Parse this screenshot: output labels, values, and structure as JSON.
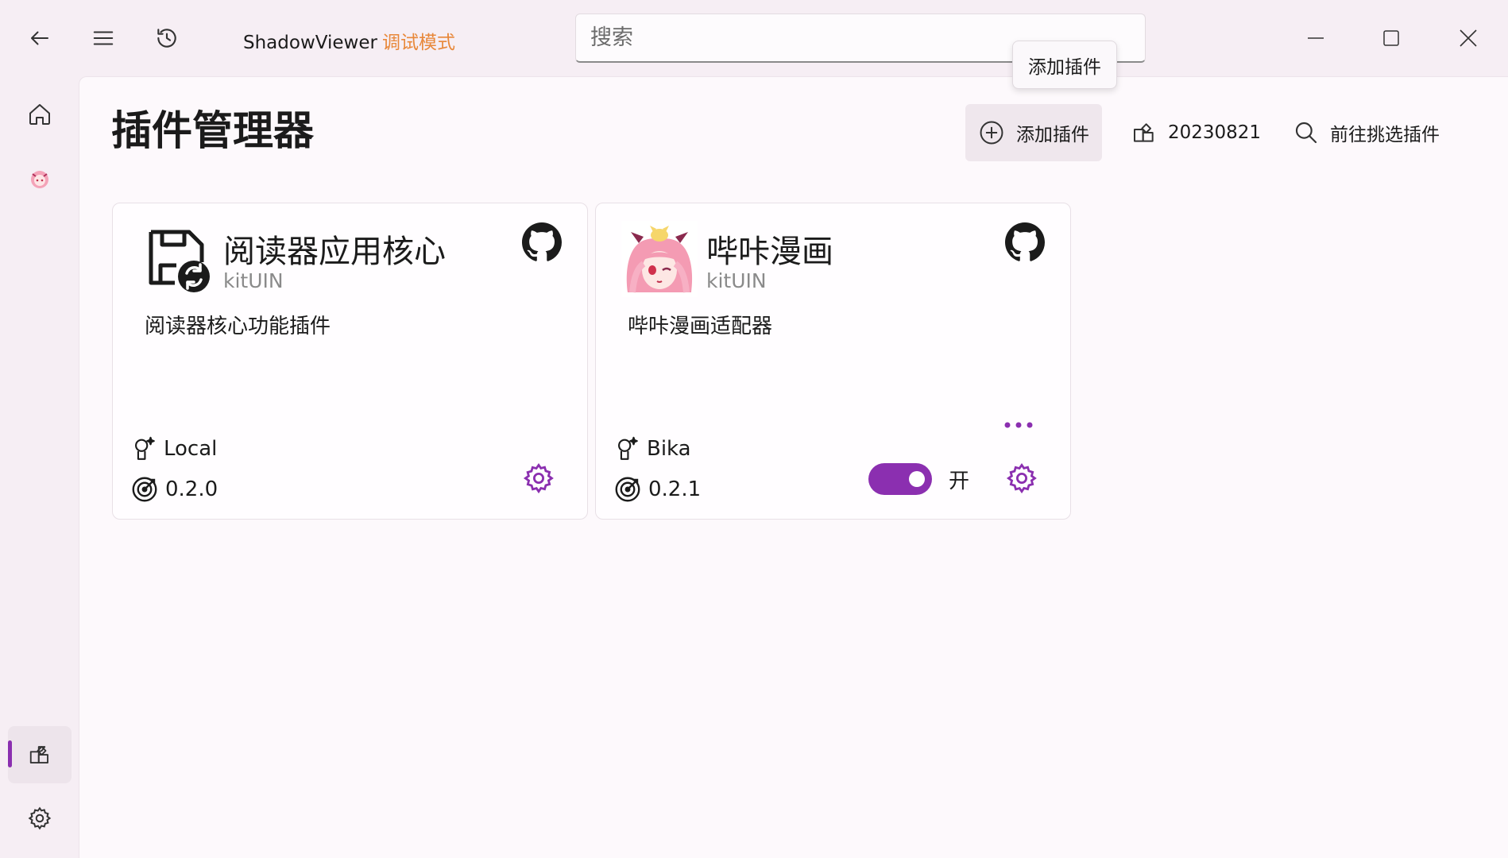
{
  "app": {
    "name": "ShadowViewer",
    "mode": "调试模式"
  },
  "search": {
    "placeholder": "搜索"
  },
  "tooltip": {
    "text": "添加插件"
  },
  "page": {
    "title": "插件管理器"
  },
  "commands": {
    "add_plugin": "添加插件",
    "version": "20230821",
    "browse_plugins": "前往挑选插件"
  },
  "plugins": [
    {
      "name": "阅读器应用核心",
      "author": "kitUIN",
      "description": "阅读器核心功能插件",
      "tag": "Local",
      "version": "0.2.0",
      "icon": "save-sync-icon"
    },
    {
      "name": "哔咔漫画",
      "author": "kitUIN",
      "description": "哔咔漫画适配器",
      "tag": "Bika",
      "version": "0.2.1",
      "icon": "anime-avatar",
      "enabled": true,
      "toggle_label": "开"
    }
  ],
  "colors": {
    "accent": "#8b2fb0",
    "mode_text": "#e8883a"
  }
}
